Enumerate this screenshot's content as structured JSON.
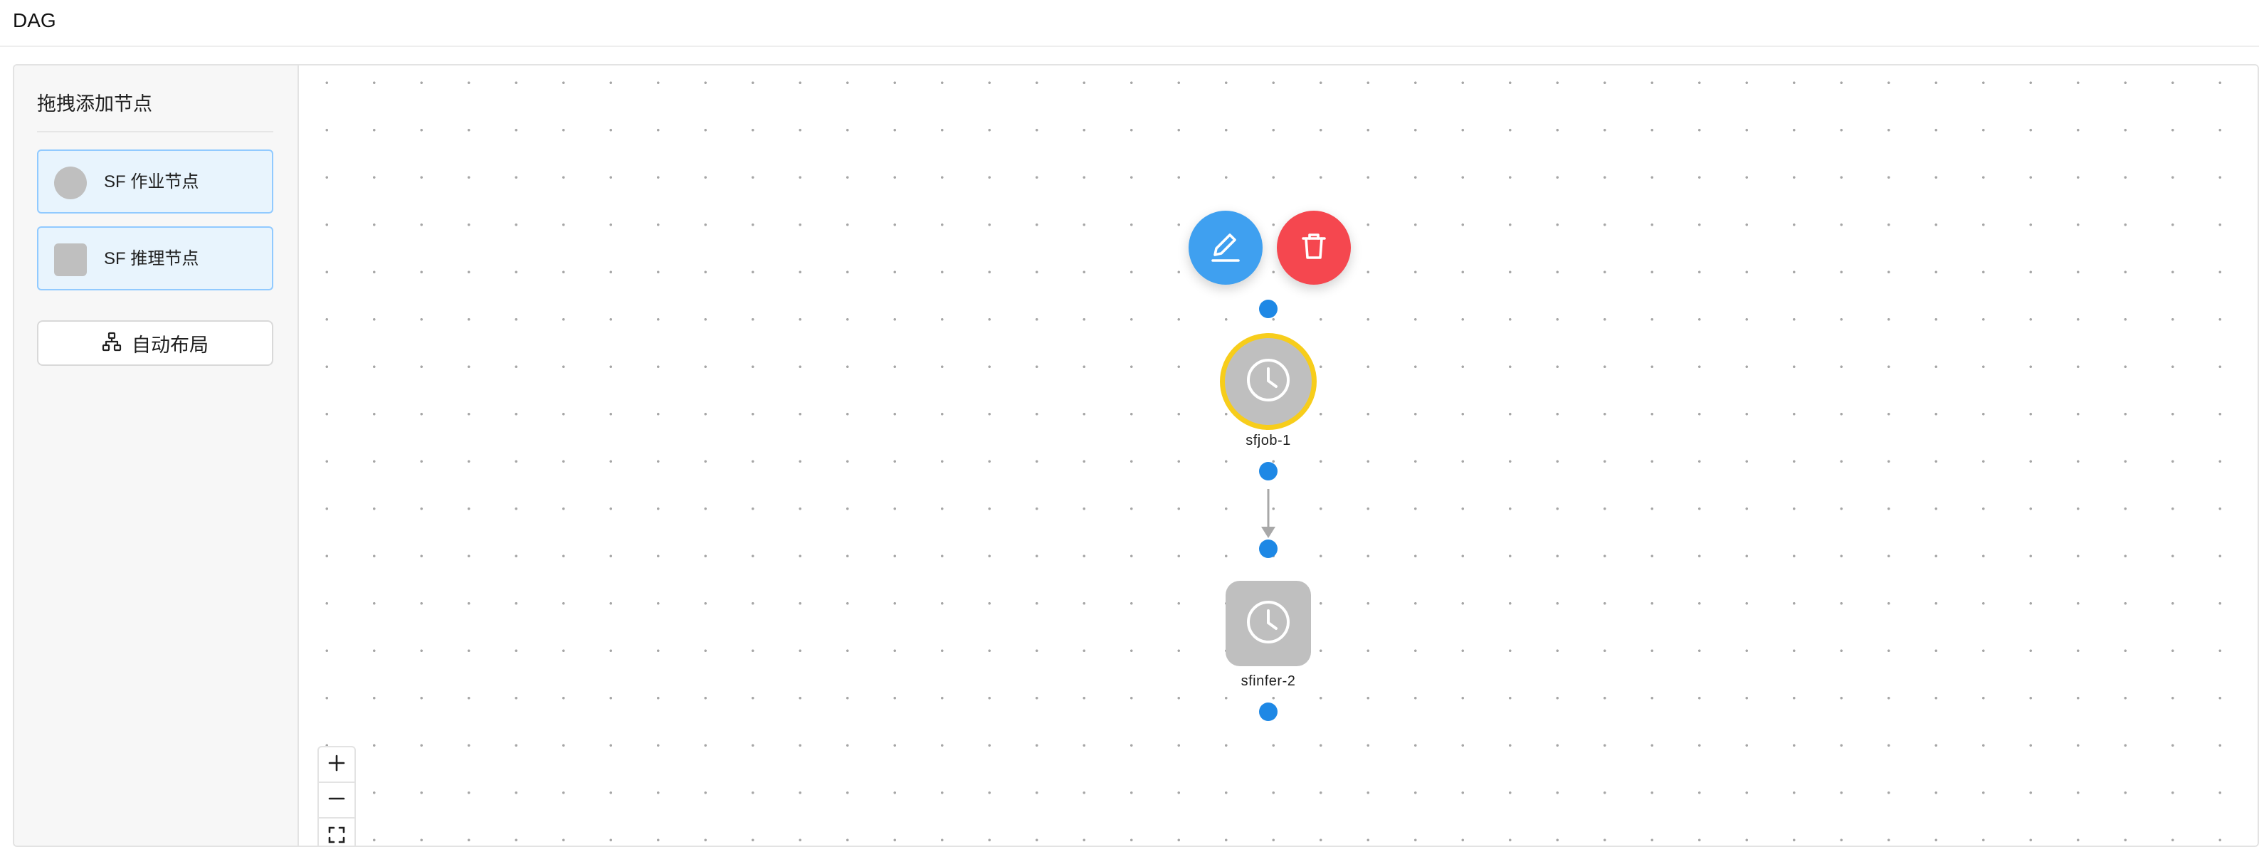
{
  "header": {
    "title": "DAG"
  },
  "sidebar": {
    "heading": "拖拽添加节点",
    "items": [
      {
        "label": "SF 作业节点",
        "shape": "circle"
      },
      {
        "label": "SF 推理节点",
        "shape": "square"
      }
    ],
    "auto_layout_label": "自动布局"
  },
  "graph": {
    "nodes": [
      {
        "id": "sfjob-1",
        "label": "sfjob-1",
        "shape": "circle",
        "selected": true,
        "icon": "clock-icon"
      },
      {
        "id": "sfinfer-2",
        "label": "sfinfer-2",
        "shape": "square",
        "selected": false,
        "icon": "clock-icon"
      }
    ],
    "edges": [
      {
        "from": "sfjob-1",
        "to": "sfinfer-2"
      }
    ],
    "actions": [
      {
        "name": "edit",
        "icon": "edit-icon"
      },
      {
        "name": "delete",
        "icon": "trash-icon"
      }
    ]
  },
  "zoom_controls": [
    {
      "name": "zoom-in",
      "icon": "plus-icon"
    },
    {
      "name": "zoom-out",
      "icon": "minus-icon"
    },
    {
      "name": "fit-view",
      "icon": "fit-view-icon"
    }
  ],
  "colors": {
    "accent": "#1e88e5",
    "edit_button": "#3fa0f0",
    "delete_button": "#f5474f",
    "selected_border": "#f7cd1b",
    "node_fill": "#bfbfbf",
    "palette_bg": "#e8f4fd",
    "palette_border": "#91caff",
    "edge": "#a8a8a8"
  }
}
